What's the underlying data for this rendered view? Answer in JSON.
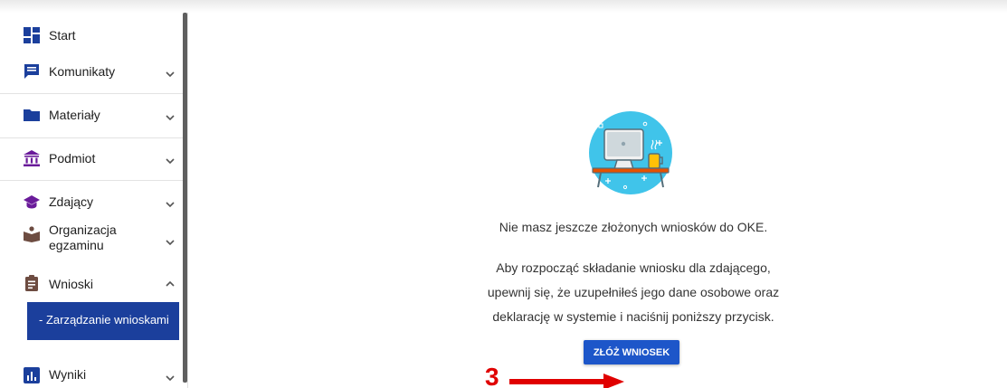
{
  "sidebar": {
    "items": [
      {
        "label": "Start",
        "icon": "dashboard-icon",
        "color": "#1b3f9c"
      },
      {
        "label": "Komunikaty",
        "icon": "message-icon",
        "color": "#1b3f9c"
      },
      {
        "label": "Materiały",
        "icon": "folder-icon",
        "color": "#1b3f9c"
      },
      {
        "label": "Podmiot",
        "icon": "institution-icon",
        "color": "#6a1b9a"
      },
      {
        "label": "Zdający",
        "icon": "graduation-cap-icon",
        "color": "#6a1b9a"
      },
      {
        "label": "Organizacja\negzaminu",
        "icon": "organization-icon",
        "color": "#6d4c41"
      },
      {
        "label": "Wnioski",
        "icon": "clipboard-icon",
        "color": "#6d4c41"
      },
      {
        "label": "Wyniki",
        "icon": "bar-chart-icon",
        "color": "#1b3f9c"
      }
    ],
    "subitem": {
      "label": "- Zarządzanie wnioskami"
    }
  },
  "main": {
    "empty_title": "Nie masz jeszcze złożonych wniosków do OKE.",
    "description_lines": [
      "Aby rozpocząć składanie wniosku dla zdającego,",
      "upewnij się, że uzupełniłeś jego dane osobowe oraz",
      "deklarację w systemie i naciśnij poniższy przycisk."
    ],
    "button_label": "ZŁÓŻ WNIOSEK"
  },
  "annotation": {
    "step": "3",
    "color": "#e00000"
  },
  "colors": {
    "primary": "#1b3f9c",
    "button": "#1d56c9",
    "illustration_bg": "#40c4ea"
  }
}
